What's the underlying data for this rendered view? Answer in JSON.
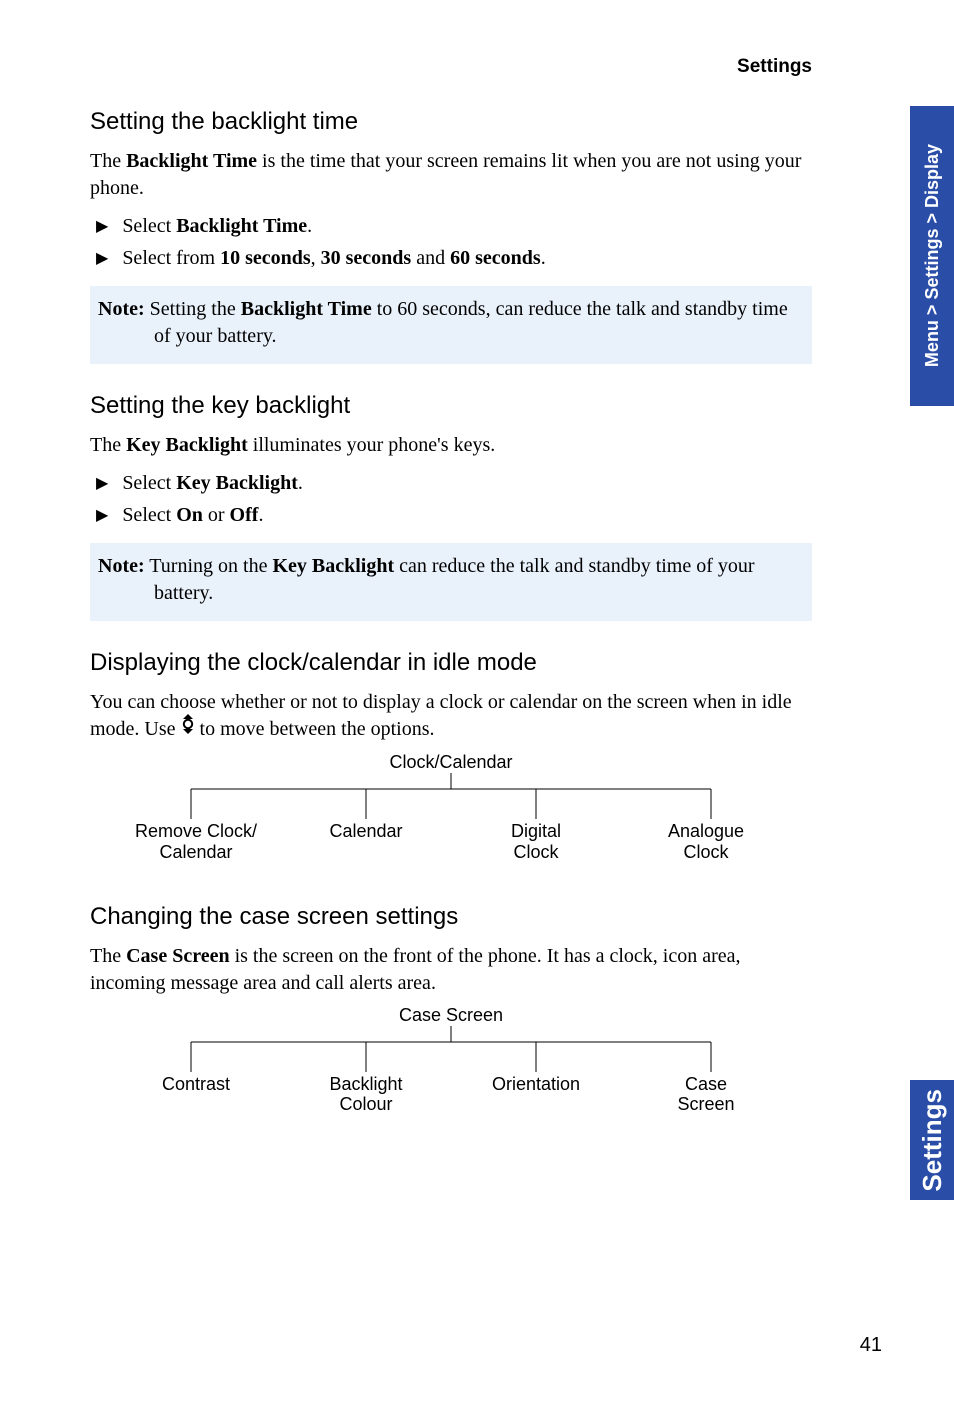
{
  "header": {
    "section": "Settings"
  },
  "sidetab": {
    "breadcrumb": "Menu > Settings > Display",
    "section": "Settings"
  },
  "page_number": "41",
  "s1": {
    "heading": "Setting the backlight time",
    "para_pre": "The ",
    "para_b1": "Backlight Time",
    "para_post": " is the time that your screen remains lit when you are not using your phone.",
    "bullet1_pre": "Select ",
    "bullet1_b": "Backlight Time",
    "bullet1_post": ".",
    "bullet2_pre": "Select from ",
    "bullet2_b1": "10 seconds",
    "bullet2_mid1": ", ",
    "bullet2_b2": "30 seconds",
    "bullet2_mid2": " and ",
    "bullet2_b3": "60 seconds",
    "bullet2_post": ".",
    "note_label": "Note:",
    "note_pre": " Setting the ",
    "note_b": "Backlight Time",
    "note_post1": " to 60 seconds, can reduce the talk and standby time ",
    "note_post2": "of your battery."
  },
  "s2": {
    "heading": "Setting the key backlight",
    "para_pre": "The ",
    "para_b": "Key Backlight",
    "para_post": " illuminates your phone's keys.",
    "bullet1_pre": "Select ",
    "bullet1_b": "Key Backlight",
    "bullet1_post": ".",
    "bullet2_pre": "Select ",
    "bullet2_b1": "On",
    "bullet2_mid": " or ",
    "bullet2_b2": "Off",
    "bullet2_post": ".",
    "note_label": "Note:",
    "note_pre": " Turning on the ",
    "note_b": "Key Backlight",
    "note_post1": " can reduce the talk and standby time of your ",
    "note_post2": "battery."
  },
  "s3": {
    "heading": "Displaying the clock/calendar in idle mode",
    "para_pre": "You can choose whether or not to display a clock or calendar on the screen when in idle mode. Use ",
    "para_post": " to move between the options."
  },
  "chart_data": [
    {
      "type": "tree",
      "title": "Clock/Calendar",
      "children": [
        "Remove Clock/ Calendar",
        "Calendar",
        "Digital Clock",
        "Analogue Clock"
      ]
    },
    {
      "type": "tree",
      "title": "Case Screen",
      "children": [
        "Contrast",
        "Backlight Colour",
        "Orientation",
        "Case Screen"
      ]
    }
  ],
  "diagram1": {
    "title": "Clock/Calendar",
    "leaf1a": "Remove Clock/",
    "leaf1b": "Calendar",
    "leaf2": "Calendar",
    "leaf3a": "Digital",
    "leaf3b": "Clock",
    "leaf4a": "Analogue",
    "leaf4b": "Clock"
  },
  "s4": {
    "heading": "Changing the case screen settings",
    "para_pre": "The ",
    "para_b": "Case Screen",
    "para_post": " is the screen on the front of the phone. It has a clock, icon area, incoming message area and call alerts area."
  },
  "diagram2": {
    "title": "Case Screen",
    "leaf1": "Contrast",
    "leaf2a": "Backlight",
    "leaf2b": "Colour",
    "leaf3": "Orientation",
    "leaf4a": "Case",
    "leaf4b": "Screen"
  }
}
